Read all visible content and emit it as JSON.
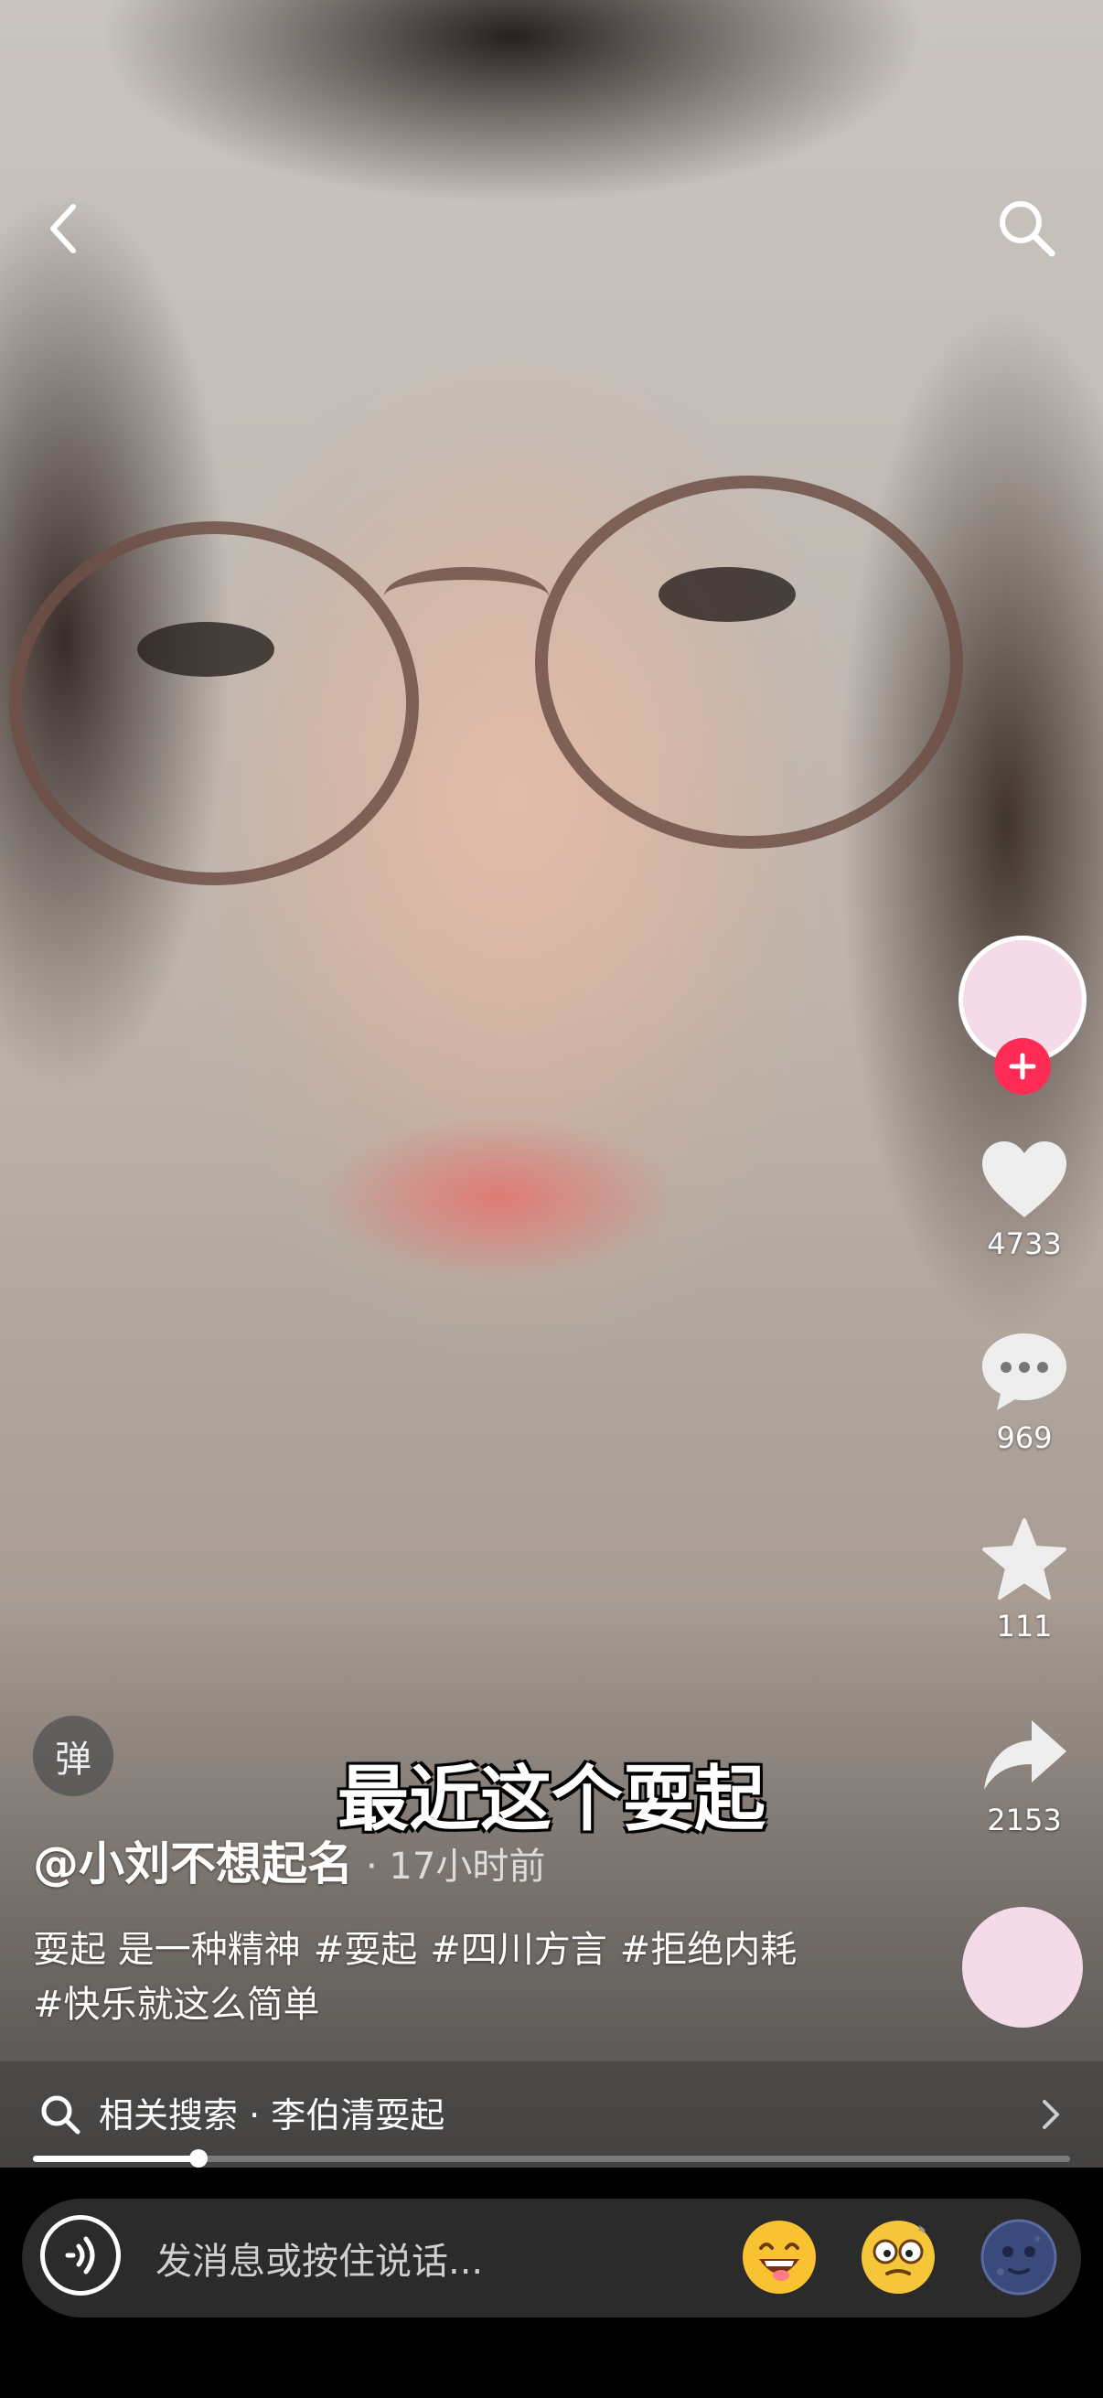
{
  "video": {
    "subtitle": "最近这个耍起"
  },
  "header": {
    "back_icon": "chevron-left-icon",
    "search_icon": "search-icon"
  },
  "sidebar": {
    "like_count": "4733",
    "comment_count": "969",
    "favorite_count": "111",
    "share_count": "2153",
    "follow_color": "#fe2c55"
  },
  "post": {
    "danmaku_label": "弹",
    "author": "@小刘不想起名",
    "time": "· 17小时前",
    "description_line1": [
      "耍起 是一种精神",
      "#耍起",
      "#四川方言",
      "#拒绝内耗"
    ],
    "description_line2": [
      "#快乐就这么简单"
    ]
  },
  "related_search": {
    "label": "相关搜索 · 李伯清耍起"
  },
  "playback": {
    "progress": 0.16
  },
  "message_bar": {
    "placeholder": "发消息或按住说话..."
  }
}
